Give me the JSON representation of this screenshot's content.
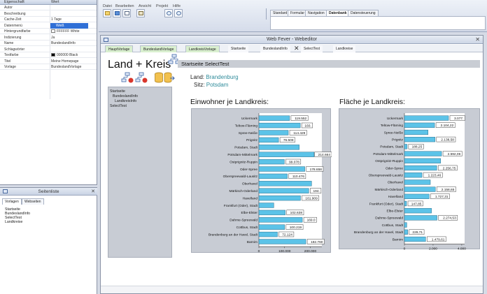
{
  "properties": {
    "header": {
      "col_name": "Eigenschaft",
      "col_value": "Wert"
    },
    "rows": [
      {
        "key": "Autor",
        "value": ""
      },
      {
        "key": "Beschreibung",
        "value": ""
      },
      {
        "key": "Cache-Zeit",
        "value": "1 Tage"
      },
      {
        "key": "Datenmenü",
        "value": "Weiß",
        "selected": true
      },
      {
        "key": "Hintergrundfarbe",
        "value": "FFFFFF White",
        "swatch": "#ffffff"
      },
      {
        "key": "Indizierung",
        "value": "Ja"
      },
      {
        "key": "Name",
        "value": "BundeslandInfo"
      },
      {
        "key": "Schlagwörter",
        "value": ""
      },
      {
        "key": "Textfarbe",
        "value": "000000 Black",
        "swatch": "#000000"
      },
      {
        "key": "Titel",
        "value": "Meine Homepage"
      },
      {
        "key": "Vorlage",
        "value": "BundeslandVorlage"
      }
    ]
  },
  "page_list": {
    "title": "Seitenliste",
    "tabs": [
      "Vorlagen",
      "Webseiten"
    ],
    "items": [
      "Startseite",
      "BundeslandInfo",
      "SelectTest",
      "Landkreise"
    ]
  },
  "ribbon": {
    "menu": [
      "Datei",
      "Bearbeiten",
      "Ansicht",
      "Projekt",
      "Hilfe"
    ],
    "tabs": [
      "Standard",
      "Formular",
      "Navigation",
      "Datenbank",
      "Datensteuerung"
    ],
    "active_tab": "Datenbank"
  },
  "editor": {
    "title": "Web Fever - Webeditor",
    "tabs": [
      "HauptVorlage",
      "BundeslandVorlage",
      "LandkreisVorlage",
      "Startseite",
      "BundeslandInfo",
      "SelectTest",
      "Landkreise"
    ],
    "site_title": "Land + Kreis",
    "breadcrumb": "Startseite SelectTest",
    "nav": [
      {
        "label": "Startseite",
        "indent": 0
      },
      {
        "label": "BundeslandInfo",
        "indent": 1
      },
      {
        "label": "LandkreisInfo",
        "indent": 1
      },
      {
        "label": "SelectTest",
        "indent": 0
      }
    ],
    "land_label": "Land:",
    "land_value": "Brandenburg",
    "sitz_label": "Sitz:",
    "sitz_value": "Potsdam",
    "chart1_title": "Einwohner je Landkreis:",
    "chart2_title": "Fläche je Landkreis:"
  },
  "colors": {
    "bar_fill": "#5cc3e8",
    "bar_stroke": "#2b6f8c",
    "accent_teal": "#2e8b9a"
  },
  "chart_data": [
    {
      "type": "bar",
      "orientation": "horizontal",
      "title": "Einwohner je Landkreis:",
      "categories": [
        "Uckermark",
        "Teltow-Fläming",
        "Spree-Neiße",
        "Prignitz",
        "Potsdam, Stadt",
        "Potsdam-Mittelmark",
        "Ostprignitz-Ruppin",
        "Oder-Spree",
        "Oberspreewald-Lausitz",
        "Oberhavel",
        "Märkisch-Oderland",
        "Havelland",
        "Frankfurt (Oder), Stadt",
        "Elbe-Elster",
        "Dahme-Spreewald",
        "Cottbus, Stadt",
        "Brandenburg an der Havel, Stadt",
        "Barnim"
      ],
      "values": [
        119552,
        161000,
        114429,
        76508,
        157000,
        214664,
        99078,
        178658,
        110476,
        205000,
        194000,
        161909,
        58000,
        102638,
        169000,
        100219,
        72124,
        182760
      ],
      "labels": [
        "119.552",
        "160.",
        "114.429",
        "76.508",
        "",
        "214.664",
        "99.078",
        "178.658",
        "110.476",
        "",
        "194.",
        "161.909",
        "",
        "102.638",
        "169.0",
        "100.219",
        "72.124",
        "182.760"
      ],
      "xticks": [
        "0",
        "100.000",
        "200.000"
      ],
      "xlim": [
        0,
        245000
      ]
    },
    {
      "type": "bar",
      "orientation": "horizontal",
      "title": "Fläche je Landkreis:",
      "categories": [
        "Uckermark",
        "Teltow-Fläming",
        "Spree-Neiße",
        "Prignitz",
        "Potsdam, Stadt",
        "Potsdam-Mittelmark",
        "Ostprignitz-Ruppin",
        "Oder-Spree",
        "Oberspreewald-Lausitz",
        "Oberhavel",
        "Märkisch-Oderland",
        "Havelland",
        "Frankfurt (Oder), Stadt",
        "Elbe-Elster",
        "Dahme-Spreewald",
        "Cottbus, Stadt",
        "Brandenburg an der Havel, Stadt",
        "Barnim"
      ],
      "values": [
        3077,
        2104.22,
        1648,
        2138.58,
        188.25,
        2592.06,
        2526,
        2256.75,
        1223.46,
        1808,
        2158.65,
        1727.31,
        147.85,
        1889,
        2274.53,
        164,
        229.71,
        1479.61
      ],
      "labels": [
        "3.077.",
        "2.104,22",
        "",
        "2.138,58",
        "188,25",
        "2.592,06",
        "",
        "2.256,75",
        "1.223,46",
        "",
        "2.158,65",
        "1.727,31",
        "147,85",
        "",
        "2.274,53",
        "",
        "229,71",
        "1.479,61"
      ],
      "xticks": [
        "0",
        "2.000",
        "4.000"
      ],
      "xlim": [
        0,
        4200
      ]
    }
  ]
}
